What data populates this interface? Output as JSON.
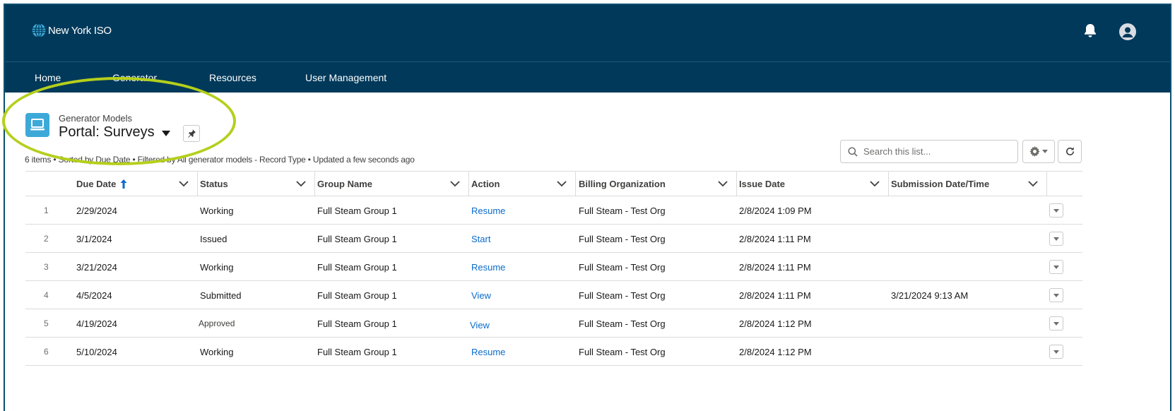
{
  "header": {
    "logo_text": "New York ISO",
    "icons": [
      "globe-logo-icon",
      "bell-icon",
      "user-avatar-icon"
    ]
  },
  "nav": {
    "items": [
      {
        "label": "Home"
      },
      {
        "label": "Generator"
      },
      {
        "label": "Resources"
      },
      {
        "label": "User Management"
      }
    ]
  },
  "list_view": {
    "object_label": "Generator Models",
    "title": "Portal: Surveys",
    "meta": "6 items • Sorted by Due Date • Filtered by All generator models - Record Type • Updated a few seconds ago",
    "search": {
      "placeholder": "Search this list..."
    }
  },
  "table": {
    "columns": [
      {
        "label": "Due Date",
        "sorted": "ascending"
      },
      {
        "label": "Status"
      },
      {
        "label": "Group Name"
      },
      {
        "label": "Action"
      },
      {
        "label": "Billing Organization"
      },
      {
        "label": "Issue Date"
      },
      {
        "label": "Submission Date/Time"
      }
    ],
    "rows": [
      {
        "num": "1",
        "due_date": "2/29/2024",
        "status": "Working",
        "group_name": "Full Steam Group 1",
        "action": "Resume",
        "billing_org": "Full Steam - Test Org",
        "issue_date": "2/8/2024 1:09 PM",
        "submission": ""
      },
      {
        "num": "2",
        "due_date": "3/1/2024",
        "status": "Issued",
        "group_name": "Full Steam Group 1",
        "action": "Start",
        "billing_org": "Full Steam - Test Org",
        "issue_date": "2/8/2024 1:11 PM",
        "submission": ""
      },
      {
        "num": "3",
        "due_date": "3/21/2024",
        "status": "Working",
        "group_name": "Full Steam Group 1",
        "action": "Resume",
        "billing_org": "Full Steam - Test Org",
        "issue_date": "2/8/2024 1:11 PM",
        "submission": ""
      },
      {
        "num": "4",
        "due_date": "4/5/2024",
        "status": "Submitted",
        "group_name": "Full Steam Group 1",
        "action": "View",
        "billing_org": "Full Steam - Test Org",
        "issue_date": "2/8/2024 1:11 PM",
        "submission": "3/21/2024 9:13 AM"
      },
      {
        "num": "5",
        "due_date": "4/19/2024",
        "status": "Approved",
        "group_name": "Full Steam Group 1",
        "action": "View",
        "billing_org": "Full Steam - Test Org",
        "issue_date": "2/8/2024 1:12 PM",
        "submission": ""
      },
      {
        "num": "6",
        "due_date": "5/10/2024",
        "status": "Working",
        "group_name": "Full Steam Group 1",
        "action": "Resume",
        "billing_org": "Full Steam - Test Org",
        "issue_date": "2/8/2024 1:12 PM",
        "submission": ""
      }
    ]
  },
  "colors": {
    "header_bg": "#00395a",
    "link": "#0b6bcb",
    "object_icon": "#3da9d8",
    "highlight": "#b5cf1c"
  }
}
